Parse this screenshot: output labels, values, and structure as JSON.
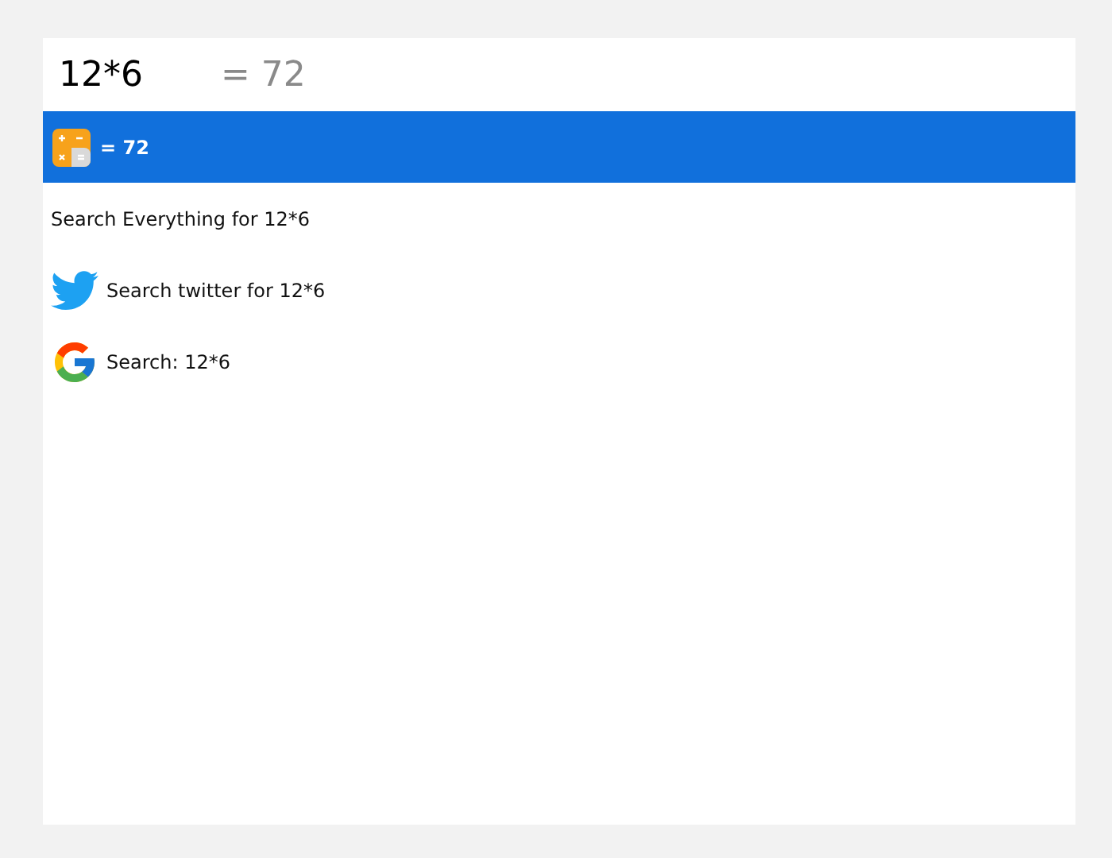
{
  "search": {
    "value": "12*6",
    "suggestion": "= 72"
  },
  "results": [
    {
      "kind": "calculator",
      "label": "= 72",
      "selected": true
    },
    {
      "kind": "plain",
      "label": "Search Everything for 12*6",
      "selected": false
    },
    {
      "kind": "twitter",
      "label": "Search twitter for 12*6",
      "selected": false
    },
    {
      "kind": "google",
      "label": "Search: 12*6",
      "selected": false
    }
  ]
}
